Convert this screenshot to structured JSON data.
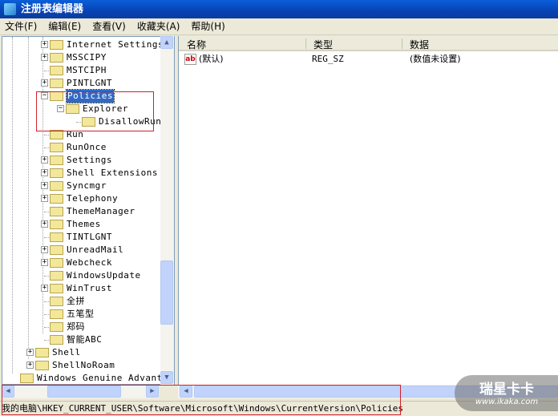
{
  "window": {
    "title": "注册表编辑器"
  },
  "menu": [
    "文件(F)",
    "编辑(E)",
    "查看(V)",
    "收藏夹(A)",
    "帮助(H)"
  ],
  "tree": [
    {
      "label": "Internet Settings",
      "level": 1,
      "expander": "+"
    },
    {
      "label": "MSSCIPY",
      "level": 1,
      "expander": "+"
    },
    {
      "label": "MSTCIPH",
      "level": 1,
      "expander": ""
    },
    {
      "label": "PINTLGNT",
      "level": 1,
      "expander": "+"
    },
    {
      "label": "Policies",
      "level": 1,
      "expander": "-",
      "selected": true
    },
    {
      "label": "Explorer",
      "level": 2,
      "expander": "-"
    },
    {
      "label": "DisallowRun",
      "level": 3,
      "expander": ""
    },
    {
      "label": "Run",
      "level": 1,
      "expander": ""
    },
    {
      "label": "RunOnce",
      "level": 1,
      "expander": ""
    },
    {
      "label": "Settings",
      "level": 1,
      "expander": "+"
    },
    {
      "label": "Shell Extensions",
      "level": 1,
      "expander": "+"
    },
    {
      "label": "Syncmgr",
      "level": 1,
      "expander": "+"
    },
    {
      "label": "Telephony",
      "level": 1,
      "expander": "+"
    },
    {
      "label": "ThemeManager",
      "level": 1,
      "expander": ""
    },
    {
      "label": "Themes",
      "level": 1,
      "expander": "+"
    },
    {
      "label": "TINTLGNT",
      "level": 1,
      "expander": ""
    },
    {
      "label": "UnreadMail",
      "level": 1,
      "expander": "+"
    },
    {
      "label": "Webcheck",
      "level": 1,
      "expander": "+"
    },
    {
      "label": "WindowsUpdate",
      "level": 1,
      "expander": ""
    },
    {
      "label": "WinTrust",
      "level": 1,
      "expander": "+"
    },
    {
      "label": "全拼",
      "level": 1,
      "expander": ""
    },
    {
      "label": "五笔型",
      "level": 1,
      "expander": ""
    },
    {
      "label": "郑码",
      "level": 1,
      "expander": ""
    },
    {
      "label": "智能ABC",
      "level": 1,
      "expander": ""
    },
    {
      "label": "Shell",
      "level": 0,
      "expander": "+"
    },
    {
      "label": "ShellNoRoam",
      "level": 0,
      "expander": "+"
    },
    {
      "label": "Windows Genuine Advantage",
      "level": -1,
      "expander": ""
    }
  ],
  "values": {
    "columns": [
      "名称",
      "类型",
      "数据"
    ],
    "rows": [
      {
        "name": "(默认)",
        "type": "REG_SZ",
        "data": "(数值未设置)",
        "icon": "string-value-icon"
      }
    ]
  },
  "status": "我的电脑\\HKEY_CURRENT_USER\\Software\\Microsoft\\Windows\\CurrentVersion\\Policies",
  "watermark": {
    "brand": "瑞星卡卡",
    "url": "www.ikaka.com"
  },
  "colors": {
    "titlebar": "#0a5fd8",
    "selection": "#316ac5",
    "highlight_box": "#d0202a"
  }
}
